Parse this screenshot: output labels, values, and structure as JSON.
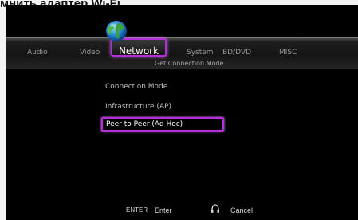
{
  "caption": "мнить адаптер Wi-Fi.",
  "menu": {
    "tabs": [
      {
        "label": "Audio"
      },
      {
        "label": "Video"
      },
      {
        "label": "Network"
      },
      {
        "label": "System"
      },
      {
        "label": "BD/DVD"
      },
      {
        "label": "MISC"
      }
    ],
    "selected_tab": "Network",
    "accent_color": "#b52fd8"
  },
  "submenu": {
    "title": "Get Connection Mode",
    "items": [
      {
        "label": "Connection Mode"
      },
      {
        "label": "Infrastructure (AP)"
      },
      {
        "label": "Peer to Peer (Ad Hoc)"
      }
    ],
    "selected_item": "Peer to Peer (Ad Hoc)"
  },
  "footer": {
    "enter_key": "ENTER",
    "enter_label": "Enter",
    "cancel_label": "Cancel",
    "cancel_icon": "headset-icon"
  },
  "icons": {
    "network": "globe-icon"
  }
}
